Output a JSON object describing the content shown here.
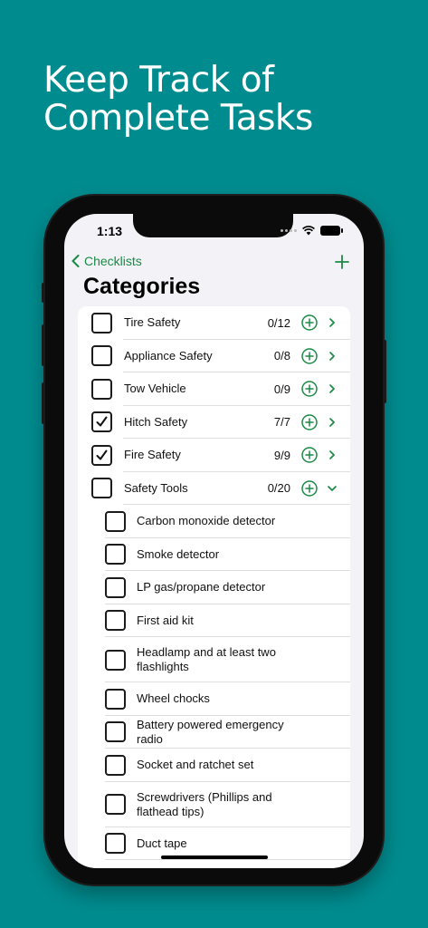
{
  "headline": {
    "line1": "Keep Track of",
    "line2": "Complete Tasks"
  },
  "status_bar": {
    "time": "1:13"
  },
  "nav": {
    "back_label": "Checklists",
    "title": "Categories"
  },
  "colors": {
    "accent": "#1a8a45",
    "background": "#008c8f"
  },
  "categories": [
    {
      "label": "Tire Safety",
      "count": "0/12",
      "checked": false,
      "expanded": false
    },
    {
      "label": "Appliance Safety",
      "count": "0/8",
      "checked": false,
      "expanded": false
    },
    {
      "label": "Tow Vehicle",
      "count": "0/9",
      "checked": false,
      "expanded": false
    },
    {
      "label": "Hitch Safety",
      "count": "7/7",
      "checked": true,
      "expanded": false
    },
    {
      "label": "Fire Safety",
      "count": "9/9",
      "checked": true,
      "expanded": false
    },
    {
      "label": "Safety Tools",
      "count": "0/20",
      "checked": false,
      "expanded": true
    }
  ],
  "safety_tools_items": [
    {
      "label": "Carbon monoxide detector",
      "checked": false
    },
    {
      "label": "Smoke detector",
      "checked": false
    },
    {
      "label": "LP gas/propane detector",
      "checked": false
    },
    {
      "label": "First aid kit",
      "checked": false
    },
    {
      "label": "Headlamp and at least two flashlights",
      "checked": false
    },
    {
      "label": "Wheel chocks",
      "checked": false
    },
    {
      "label": "Battery powered emergency radio",
      "checked": false
    },
    {
      "label": "Socket and ratchet set",
      "checked": false
    },
    {
      "label": "Screwdrivers (Phillips and flathead tips)",
      "checked": false
    },
    {
      "label": "Duct tape",
      "checked": false
    }
  ]
}
